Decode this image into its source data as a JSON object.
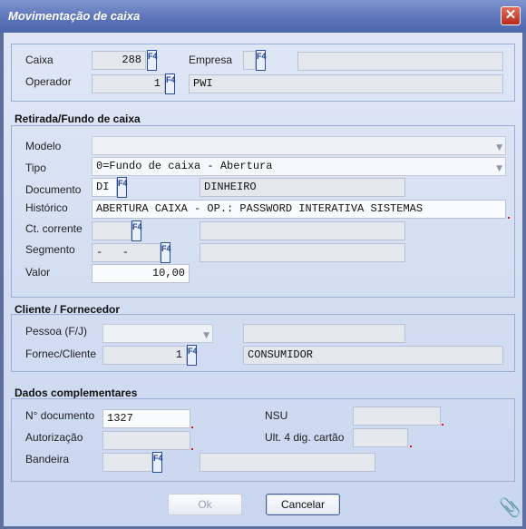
{
  "window": {
    "title": "Movimentação de caixa",
    "close_glyph": "✕"
  },
  "f4_label": "F4",
  "header": {
    "caixa_label": "Caixa",
    "caixa_value": "288",
    "empresa_label": "Empresa",
    "empresa_code": "",
    "empresa_name": "",
    "operador_label": "Operador",
    "operador_value": "1",
    "operador_name": "PWI"
  },
  "retirada": {
    "section_title": "Retirada/Fundo de caixa",
    "modelo_label": "Modelo",
    "modelo_value": "",
    "tipo_label": "Tipo",
    "tipo_value": "0=Fundo de caixa - Abertura",
    "documento_label": "Documento",
    "documento_code": "DI",
    "documento_name": "DINHEIRO",
    "historico_label": "Histórico",
    "historico_value": "ABERTURA CAIXA - OP.: PASSWORD INTERATIVA SISTEMAS",
    "ct_corrente_label": "Ct. corrente",
    "ct_corrente_code": "",
    "ct_corrente_name": "",
    "segmento_label": "Segmento",
    "segmento_value": "-   -",
    "segmento_name": "",
    "valor_label": "Valor",
    "valor_value": "10,00"
  },
  "cliente": {
    "section_title": "Cliente / Fornecedor",
    "pessoa_label": "Pessoa (F/J)",
    "pessoa_value": "",
    "pessoa_extra": "",
    "fornec_label": "Fornec/Cliente",
    "fornec_code": "1",
    "fornec_name": "CONSUMIDOR"
  },
  "complementares": {
    "section_title": "Dados complementares",
    "nr_documento_label": "N° documento",
    "nr_documento_value": "1327",
    "nsu_label": "NSU",
    "nsu_value": "",
    "autorizacao_label": "Autorização",
    "autorizacao_value": "",
    "ult4_label": "Ult. 4 dig. cartão",
    "ult4_value": "",
    "bandeira_label": "Bandeira",
    "bandeira_code": "",
    "bandeira_name": ""
  },
  "buttons": {
    "ok_label": "Ok",
    "cancel_label": "Cancelar"
  },
  "icons": {
    "close": "close-icon",
    "dropdown": "chevron-down-icon",
    "attach": "paperclip-icon",
    "lookup": "f4-lookup-icon"
  }
}
